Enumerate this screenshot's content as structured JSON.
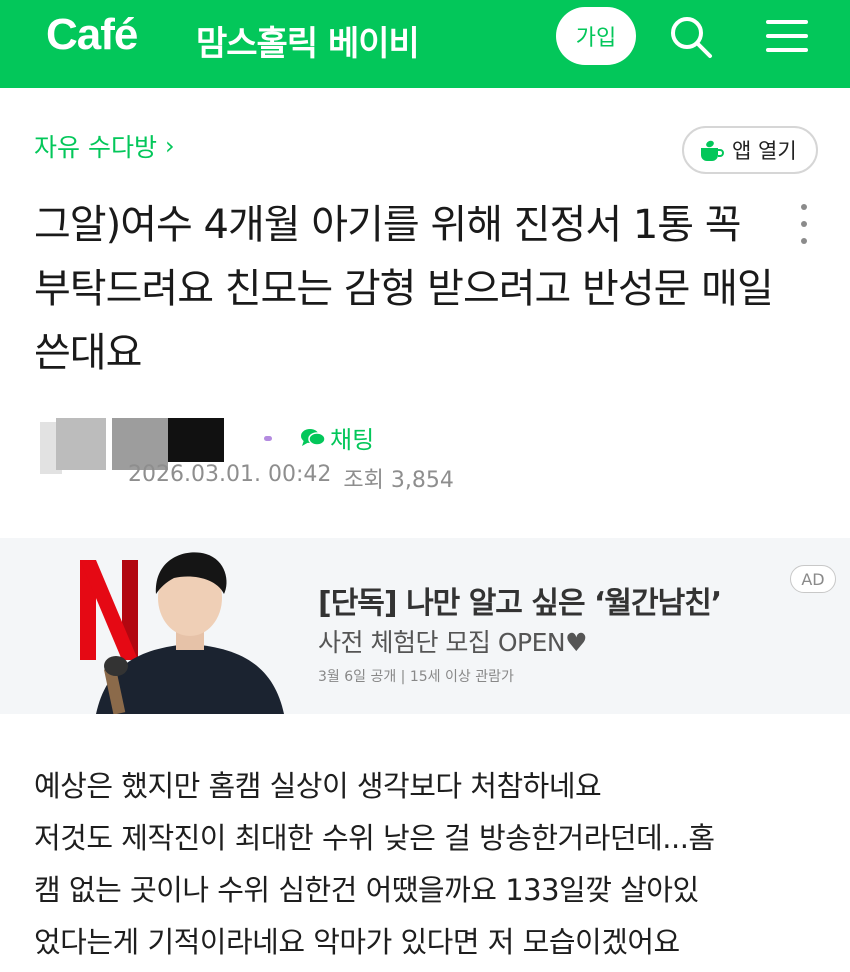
{
  "header": {
    "logo": "Café",
    "cafe_name": "맘스홀릭 베이비",
    "join_label": "가입",
    "search_icon": "search-icon",
    "menu_icon": "hamburger-menu-icon",
    "bg_color": "#03c75a"
  },
  "board": {
    "name": "자유 수다방",
    "chevron": "›",
    "app_open_label": "앱 열기"
  },
  "post": {
    "title": "그알)여수 4개월 아기를 위해 진정서 1통 꼭 부탁드려요 친모는 감형 받으려고 반성문 매일 쓴대요",
    "chat_label": "채팅",
    "date": "2026.03.01. 00:42",
    "views_label": "조회",
    "views": "3,854",
    "body_lines": [
      "예상은 했지만 홈캠 실상이 생각보다 처참하네요",
      "저것도 제작진이 최대한 수위 낮은 걸 방송한거라던데...홈",
      "캠 없는 곳이나 수위 심한건 어땠을까요 133일깢 살아있",
      "었다는게 기적이라네요 악마가 있다면 저 모습이겠어요"
    ]
  },
  "ad": {
    "badge": "AD",
    "title": "[단독] 나만 알고 싶은 ‘월간남친’",
    "subtitle": "사전 체험단 모집 OPEN♥",
    "info": "3월 6일 공개 | 15세 이상 관람가",
    "logo_letter": "N",
    "logo_color": "#e50914"
  }
}
